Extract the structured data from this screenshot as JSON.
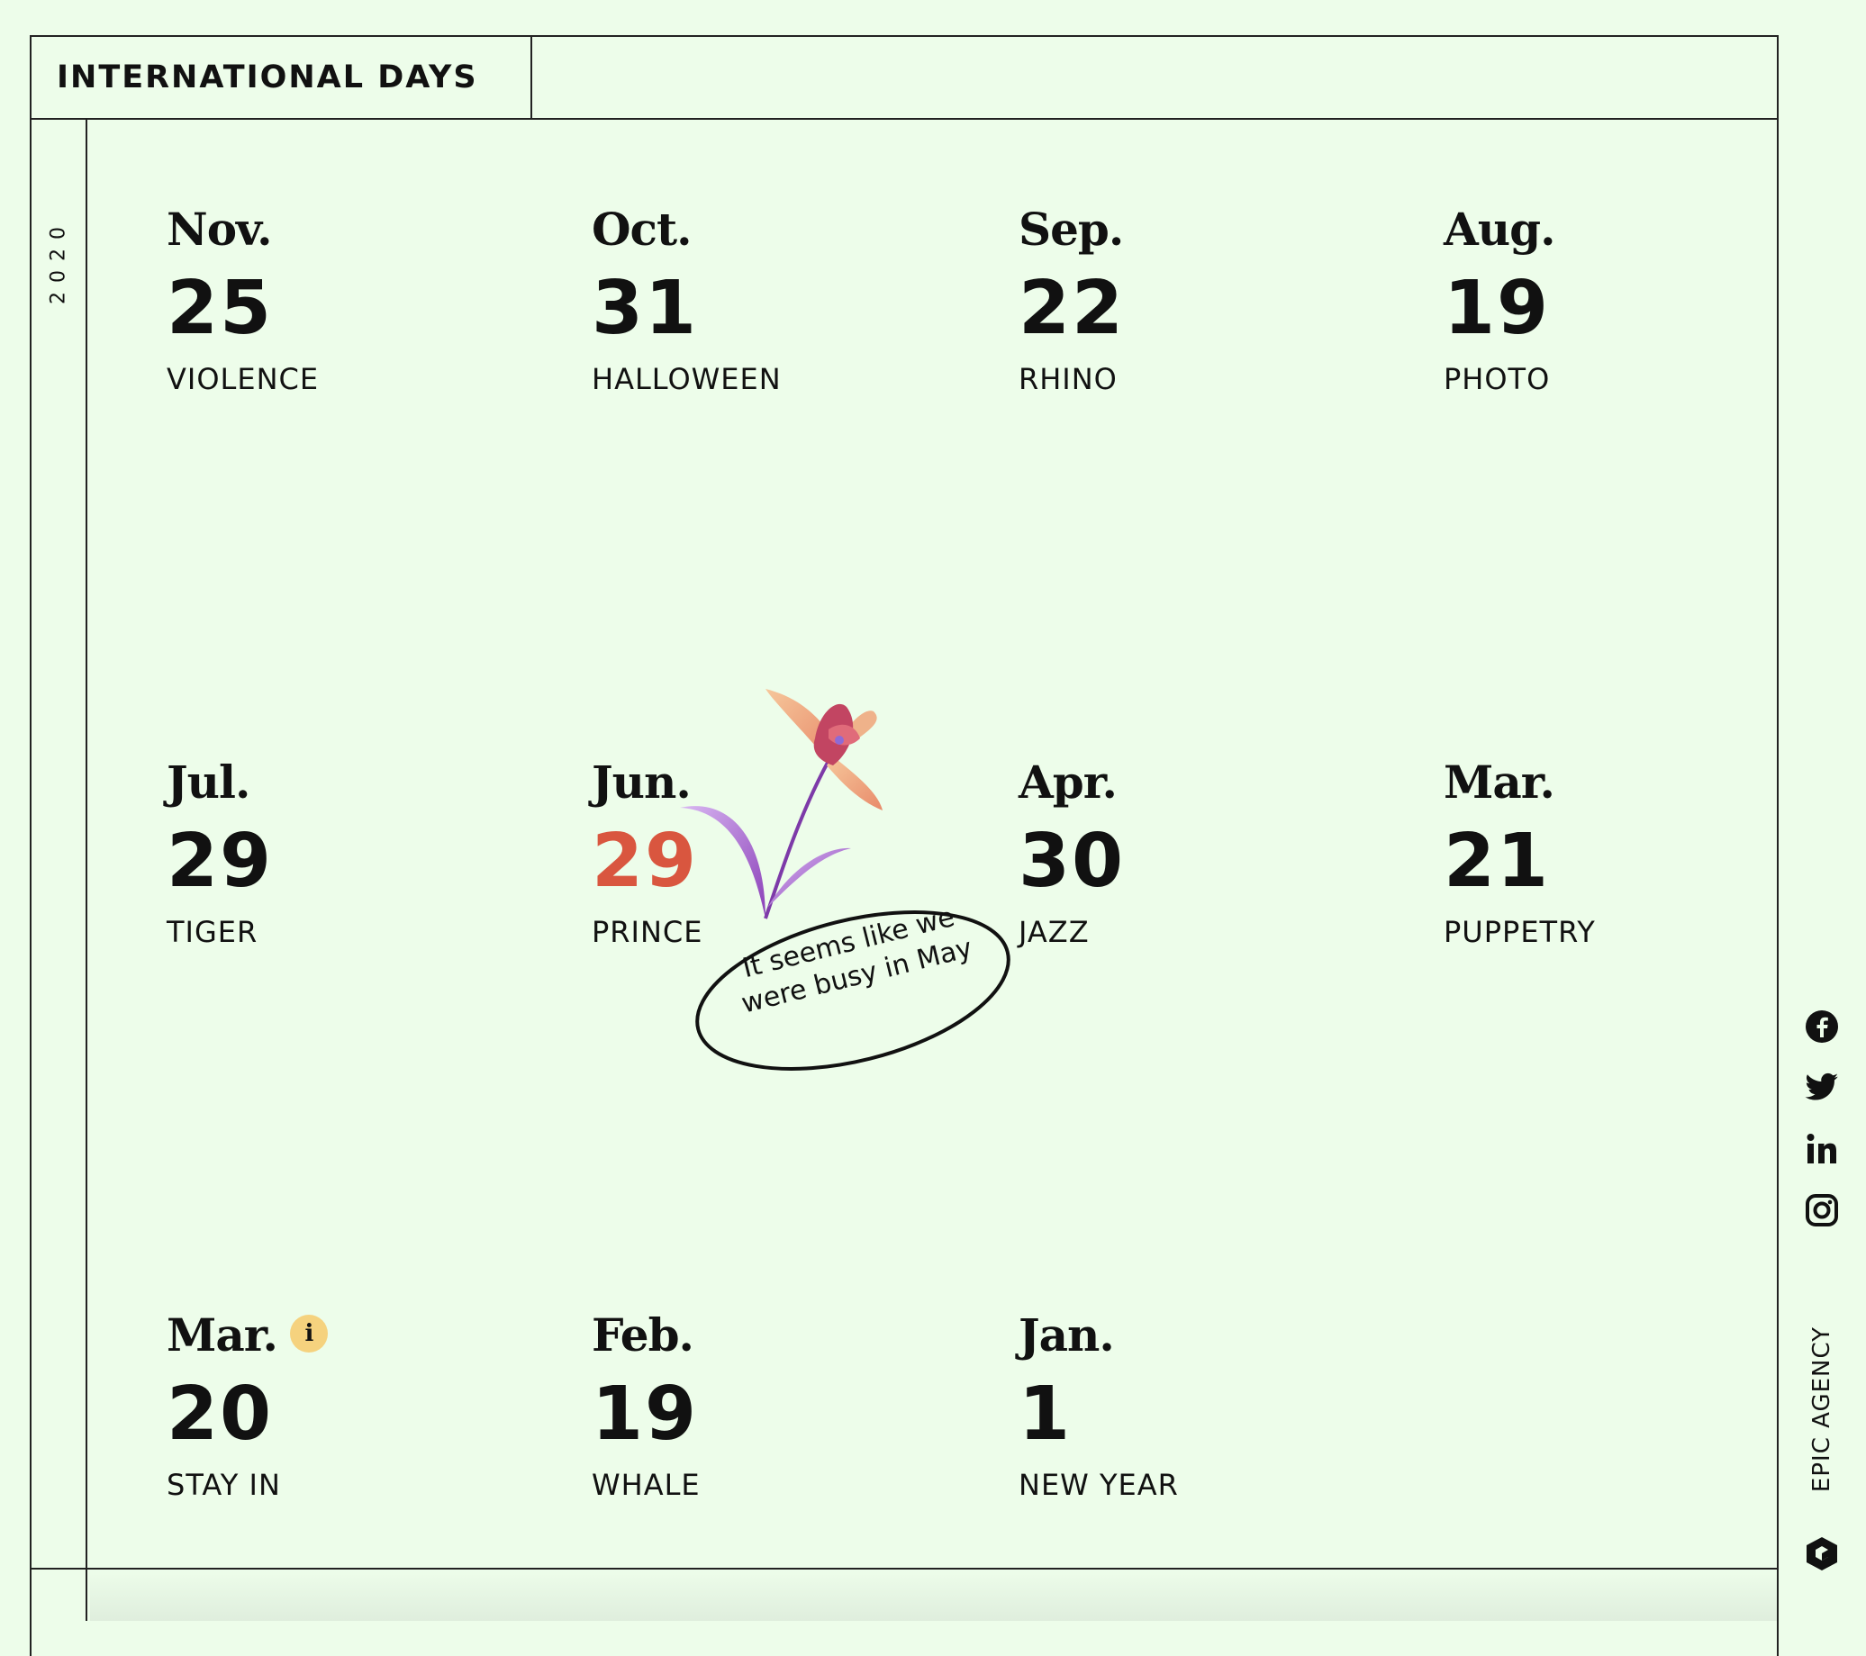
{
  "header": {
    "title": "INTERNATIONAL DAYS"
  },
  "year": "2020",
  "days": [
    {
      "month": "Nov.",
      "day": "25",
      "name": "VIOLENCE"
    },
    {
      "month": "Oct.",
      "day": "31",
      "name": "HALLOWEEN"
    },
    {
      "month": "Sep.",
      "day": "22",
      "name": "RHINO"
    },
    {
      "month": "Aug.",
      "day": "19",
      "name": "PHOTO"
    },
    {
      "month": "Jul.",
      "day": "29",
      "name": "TIGER"
    },
    {
      "month": "Jun.",
      "day": "29",
      "name": "PRINCE",
      "highlight": "#d9563f"
    },
    {
      "month": "Apr.",
      "day": "30",
      "name": "JAZZ"
    },
    {
      "month": "Mar.",
      "day": "21",
      "name": "PUPPETRY"
    },
    {
      "month": "Mar.",
      "day": "20",
      "name": "STAY IN",
      "info_badge": "i"
    },
    {
      "month": "Feb.",
      "day": "19",
      "name": "WHALE"
    },
    {
      "month": "Jan.",
      "day": "1",
      "name": "NEW YEAR"
    }
  ],
  "note": {
    "line1": "It seems like we",
    "line2": "were busy in May"
  },
  "social": [
    {
      "icon": "facebook-icon"
    },
    {
      "icon": "twitter-icon"
    },
    {
      "icon": "linkedin-icon"
    },
    {
      "icon": "instagram-icon"
    }
  ],
  "brand": {
    "label": "EPIC AGENCY",
    "icon": "epic-agency-logo-icon"
  },
  "colors": {
    "background": "#edfdea",
    "accent": "#d9563f",
    "badge": "#f5d27e",
    "ink": "#111111"
  }
}
